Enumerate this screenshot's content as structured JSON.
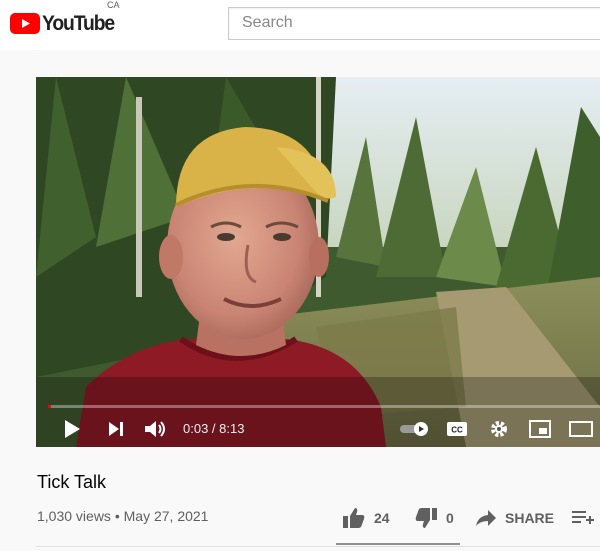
{
  "header": {
    "logo_text": "YouTube",
    "country": "CA",
    "search_placeholder": "Search"
  },
  "player": {
    "current_time": "0:03",
    "duration": "8:13",
    "time_display": "0:03 / 8:13",
    "progress_fraction": 0.006,
    "accent_color": "#ff0000"
  },
  "video": {
    "title": "Tick Talk",
    "views": "1,030 views",
    "separator": "•",
    "date": "May 27, 2021",
    "meta_line": "1,030 views • May 27, 2021",
    "likes": "24",
    "dislikes": "0",
    "share_label": "SHARE"
  },
  "icons": [
    "youtube-logo-icon",
    "play-icon",
    "next-icon",
    "volume-icon",
    "autoplay-toggle-icon",
    "captions-icon",
    "settings-gear-icon",
    "miniplayer-icon",
    "theater-icon",
    "thumbs-up-icon",
    "thumbs-down-icon",
    "share-arrow-icon",
    "save-playlist-icon"
  ]
}
